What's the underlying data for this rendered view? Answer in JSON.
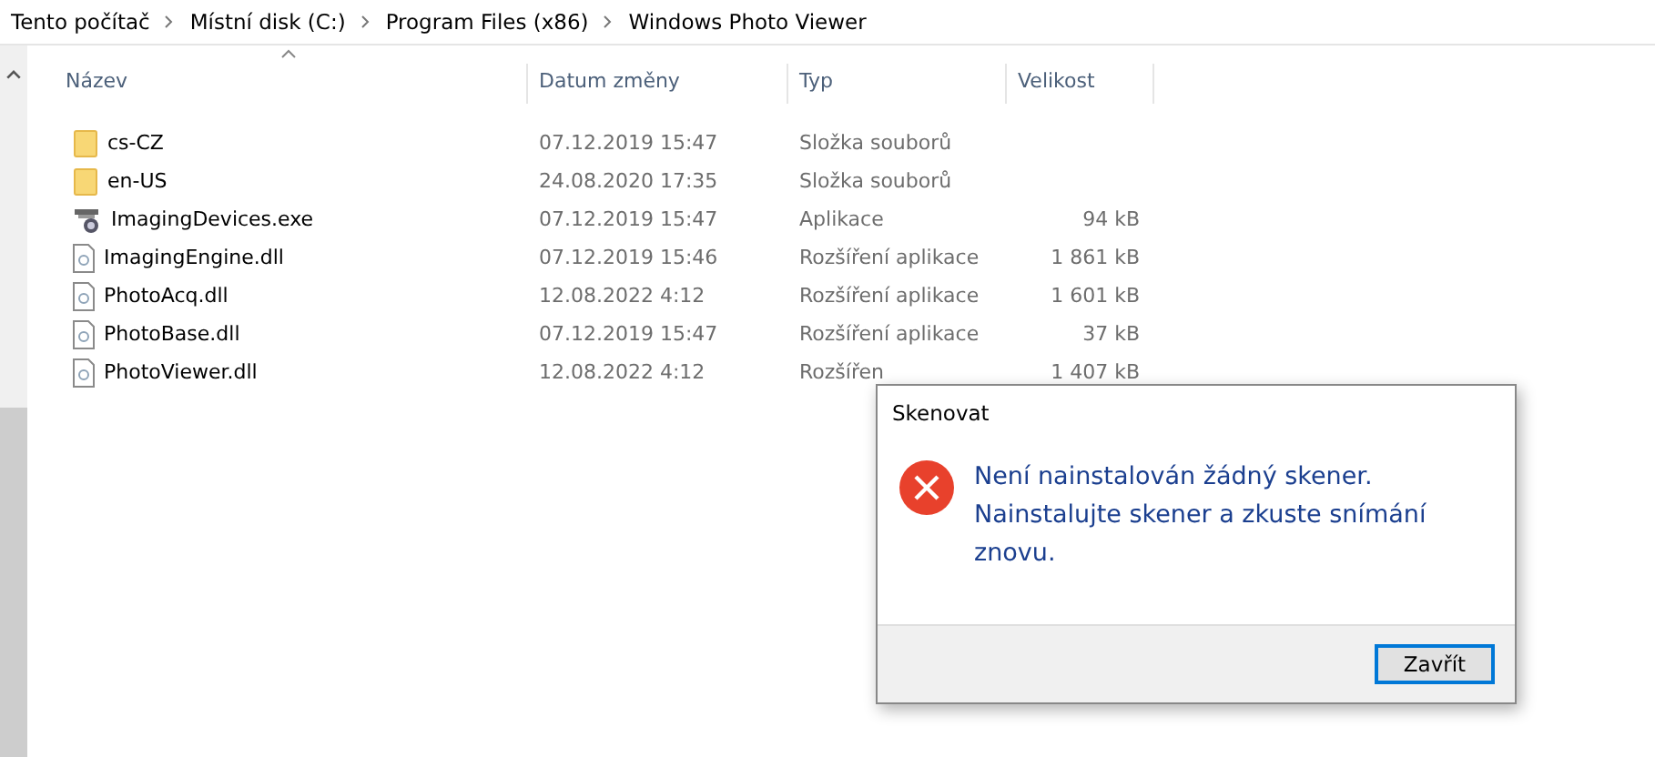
{
  "breadcrumb": [
    "Tento počítač",
    "Místní disk (C:)",
    "Program Files (x86)",
    "Windows Photo Viewer"
  ],
  "columns": [
    {
      "label": "Název",
      "sorted": true
    },
    {
      "label": "Datum změny",
      "sorted": false
    },
    {
      "label": "Typ",
      "sorted": false
    },
    {
      "label": "Velikost",
      "sorted": false
    }
  ],
  "rows": [
    {
      "kind": "folder",
      "name": "cs-CZ",
      "date": "07.12.2019 15:47",
      "type": "Složka souborů"
    },
    {
      "kind": "folder",
      "name": "en-US",
      "date": "24.08.2020 17:35",
      "type": "Složka souborů"
    },
    {
      "kind": "exe",
      "name": "ImagingDevices.exe",
      "date": "07.12.2019 15:47",
      "type": "Aplikace",
      "size": "94 kB"
    },
    {
      "kind": "dll",
      "name": "ImagingEngine.dll",
      "date": "07.12.2019 15:46",
      "type": "Rozšíření aplikace",
      "size": "1 861 kB"
    },
    {
      "kind": "dll",
      "name": "PhotoAcq.dll",
      "date": "12.08.2022 4:12",
      "type": "Rozšíření aplikace",
      "size": "1 601 kB"
    },
    {
      "kind": "dll",
      "name": "PhotoBase.dll",
      "date": "07.12.2019 15:47",
      "type": "Rozšíření aplikace",
      "size": "37 kB"
    },
    {
      "kind": "dll",
      "name": "PhotoViewer.dll",
      "date": "12.08.2022 4:12",
      "type": "Rozšířen",
      "size": "1 407 kB"
    }
  ],
  "dialog": {
    "title": "Skenovat",
    "message": [
      "Není nainstalován žádný skener.",
      "Nainstalujte skener a zkuste snímání znovu."
    ],
    "button": "Zavřít"
  }
}
